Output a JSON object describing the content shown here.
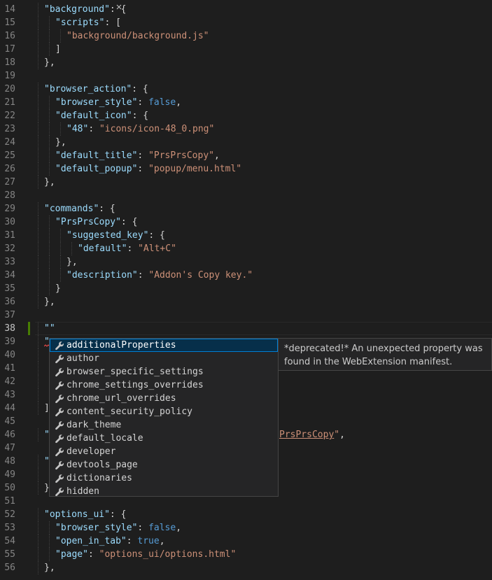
{
  "editor": {
    "lines": [
      {
        "num": "14",
        "indent": 1,
        "tokens": [
          [
            "q",
            "\"background\""
          ],
          [
            "p",
            ": {"
          ]
        ]
      },
      {
        "num": "15",
        "indent": 2,
        "tokens": [
          [
            "q",
            "\"scripts\""
          ],
          [
            "p",
            ": ["
          ]
        ]
      },
      {
        "num": "16",
        "indent": 3,
        "tokens": [
          [
            "s",
            "\"background/background.js\""
          ]
        ]
      },
      {
        "num": "17",
        "indent": 2,
        "tokens": [
          [
            "p",
            "]"
          ]
        ]
      },
      {
        "num": "18",
        "indent": 1,
        "tokens": [
          [
            "p",
            "},"
          ]
        ]
      },
      {
        "num": "19",
        "indent": 0,
        "tokens": []
      },
      {
        "num": "20",
        "indent": 1,
        "tokens": [
          [
            "q",
            "\"browser_action\""
          ],
          [
            "p",
            ": {"
          ]
        ]
      },
      {
        "num": "21",
        "indent": 2,
        "tokens": [
          [
            "q",
            "\"browser_style\""
          ],
          [
            "p",
            ": "
          ],
          [
            "b",
            "false"
          ],
          [
            "p",
            ","
          ]
        ]
      },
      {
        "num": "22",
        "indent": 2,
        "tokens": [
          [
            "q",
            "\"default_icon\""
          ],
          [
            "p",
            ": {"
          ]
        ]
      },
      {
        "num": "23",
        "indent": 3,
        "tokens": [
          [
            "q",
            "\"48\""
          ],
          [
            "p",
            ": "
          ],
          [
            "s",
            "\"icons/icon-48_0.png\""
          ]
        ]
      },
      {
        "num": "24",
        "indent": 2,
        "tokens": [
          [
            "p",
            "},"
          ]
        ]
      },
      {
        "num": "25",
        "indent": 2,
        "tokens": [
          [
            "q",
            "\"default_title\""
          ],
          [
            "p",
            ": "
          ],
          [
            "s",
            "\"PrsPrsCopy\""
          ],
          [
            "p",
            ","
          ]
        ]
      },
      {
        "num": "26",
        "indent": 2,
        "tokens": [
          [
            "q",
            "\"default_popup\""
          ],
          [
            "p",
            ": "
          ],
          [
            "s",
            "\"popup/menu.html\""
          ]
        ]
      },
      {
        "num": "27",
        "indent": 1,
        "tokens": [
          [
            "p",
            "},"
          ]
        ]
      },
      {
        "num": "28",
        "indent": 0,
        "tokens": []
      },
      {
        "num": "29",
        "indent": 1,
        "tokens": [
          [
            "q",
            "\"commands\""
          ],
          [
            "p",
            ": {"
          ]
        ]
      },
      {
        "num": "30",
        "indent": 2,
        "tokens": [
          [
            "q",
            "\"PrsPrsCopy\""
          ],
          [
            "p",
            ": {"
          ]
        ]
      },
      {
        "num": "31",
        "indent": 3,
        "tokens": [
          [
            "q",
            "\"suggested_key\""
          ],
          [
            "p",
            ": {"
          ]
        ]
      },
      {
        "num": "32",
        "indent": 4,
        "tokens": [
          [
            "q",
            "\"default\""
          ],
          [
            "p",
            ": "
          ],
          [
            "s",
            "\"Alt+C\""
          ]
        ]
      },
      {
        "num": "33",
        "indent": 3,
        "tokens": [
          [
            "p",
            "},"
          ]
        ]
      },
      {
        "num": "34",
        "indent": 3,
        "tokens": [
          [
            "q",
            "\"description\""
          ],
          [
            "p",
            ": "
          ],
          [
            "s",
            "\"Addon's Copy key.\""
          ]
        ]
      },
      {
        "num": "35",
        "indent": 2,
        "tokens": [
          [
            "p",
            "}"
          ]
        ]
      },
      {
        "num": "36",
        "indent": 1,
        "tokens": [
          [
            "p",
            "},"
          ]
        ]
      },
      {
        "num": "37",
        "indent": 0,
        "tokens": []
      },
      {
        "num": "38",
        "indent": 1,
        "current": true,
        "tokens": [
          [
            "q",
            "\"\""
          ]
        ]
      },
      {
        "num": "39",
        "indent": 1,
        "tokens": [
          [
            "q",
            "\""
          ]
        ]
      },
      {
        "num": "40",
        "indent": 1,
        "tokens": []
      },
      {
        "num": "41",
        "indent": 1,
        "tokens": []
      },
      {
        "num": "42",
        "indent": 1,
        "tokens": []
      },
      {
        "num": "43",
        "indent": 1,
        "tokens": []
      },
      {
        "num": "44",
        "indent": 1,
        "tokens": [
          [
            "p",
            "]"
          ]
        ]
      },
      {
        "num": "45",
        "indent": 0,
        "tokens": []
      },
      {
        "num": "46",
        "indent": 1,
        "tokens": [
          [
            "q",
            "\""
          ]
        ],
        "tail": [
          [
            "s",
            "PrsPrsCopy"
          ],
          [
            "s",
            "\""
          ],
          [
            "p",
            ","
          ]
        ]
      },
      {
        "num": "47",
        "indent": 0,
        "tokens": []
      },
      {
        "num": "48",
        "indent": 1,
        "tokens": [
          [
            "q",
            "\""
          ]
        ]
      },
      {
        "num": "49",
        "indent": 1,
        "tokens": []
      },
      {
        "num": "50",
        "indent": 1,
        "tokens": [
          [
            "p",
            "}"
          ]
        ]
      },
      {
        "num": "51",
        "indent": 0,
        "tokens": []
      },
      {
        "num": "52",
        "indent": 1,
        "tokens": [
          [
            "q",
            "\"options_ui\""
          ],
          [
            "p",
            ": {"
          ]
        ]
      },
      {
        "num": "53",
        "indent": 2,
        "tokens": [
          [
            "q",
            "\"browser_style\""
          ],
          [
            "p",
            ": "
          ],
          [
            "b",
            "false"
          ],
          [
            "p",
            ","
          ]
        ]
      },
      {
        "num": "54",
        "indent": 2,
        "tokens": [
          [
            "q",
            "\"open_in_tab\""
          ],
          [
            "p",
            ": "
          ],
          [
            "b",
            "true"
          ],
          [
            "p",
            ","
          ]
        ]
      },
      {
        "num": "55",
        "indent": 2,
        "tokens": [
          [
            "q",
            "\"page\""
          ],
          [
            "p",
            ": "
          ],
          [
            "s",
            "\"options_ui/options.html\""
          ]
        ]
      },
      {
        "num": "56",
        "indent": 1,
        "tokens": [
          [
            "p",
            "},"
          ]
        ]
      }
    ]
  },
  "suggest": {
    "items": [
      "additionalProperties",
      "author",
      "browser_specific_settings",
      "chrome_settings_overrides",
      "chrome_url_overrides",
      "content_security_policy",
      "dark_theme",
      "default_locale",
      "developer",
      "devtools_page",
      "dictionaries",
      "hidden"
    ],
    "selected_index": 0,
    "item_icon": "wrench-icon"
  },
  "details": {
    "text": "*deprecated!* An unexpected property was found in the WebExtension manifest."
  },
  "colors": {
    "background": "#1e1e1e",
    "key": "#9cdcfe",
    "string": "#ce9178",
    "boolean": "#569cd6",
    "line_number": "#858585",
    "modified_bar": "#487e02",
    "selection": "#062f4a",
    "focus_border": "#007fd4"
  }
}
